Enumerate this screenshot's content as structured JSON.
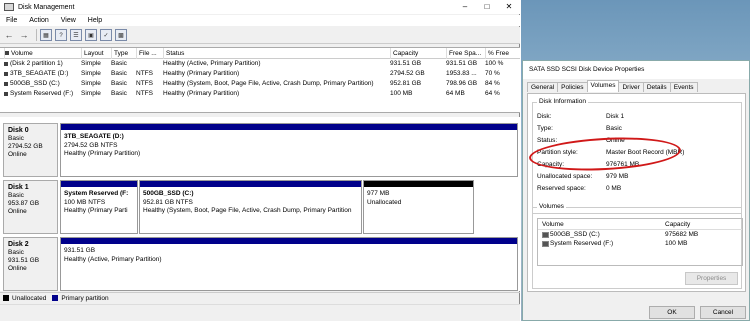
{
  "disk_management": {
    "title": "Disk Management",
    "menu": [
      "File",
      "Action",
      "View",
      "Help"
    ],
    "toolbar_icons": [
      "back-icon",
      "forward-icon",
      "console-tree-icon",
      "help-icon",
      "list-icon",
      "properties-icon",
      "refresh-icon",
      "export-icon"
    ],
    "volume_columns": [
      "Volume",
      "Layout",
      "Type",
      "File ...",
      "Status",
      "Capacity",
      "Free Spa...",
      "% Free"
    ],
    "volumes": [
      [
        "(Disk 2 partition 1)",
        "Simple",
        "Basic",
        "",
        "Healthy (Active, Primary Partition)",
        "931.51 GB",
        "931.51 GB",
        "100 %"
      ],
      [
        "3TB_SEAGATE (D:)",
        "Simple",
        "Basic",
        "NTFS",
        "Healthy (Primary Partition)",
        "2794.52 GB",
        "1953.83 ...",
        "70 %"
      ],
      [
        "500GB_SSD (C:)",
        "Simple",
        "Basic",
        "NTFS",
        "Healthy (System, Boot, Page File, Active, Crash Dump, Primary Partition)",
        "952.81 GB",
        "798.96 GB",
        "84 %"
      ],
      [
        "System Reserved (F:)",
        "Simple",
        "Basic",
        "NTFS",
        "Healthy (Primary Partition)",
        "100 MB",
        "64 MB",
        "64 %"
      ]
    ],
    "disks": [
      {
        "name": "Disk 0",
        "type": "Basic",
        "size": "2794.52 GB",
        "status": "Online",
        "partitions": [
          {
            "name": "3TB_SEAGATE  (D:)",
            "size": "2794.52 GB NTFS",
            "status": "Healthy (Primary Partition)"
          }
        ]
      },
      {
        "name": "Disk 1",
        "type": "Basic",
        "size": "953.87 GB",
        "status": "Online",
        "partitions": [
          {
            "name": "System Reserved  (F:",
            "size": "100 MB NTFS",
            "status": "Healthy (Primary Parti"
          },
          {
            "name": "500GB_SSD  (C:)",
            "size": "952.81 GB NTFS",
            "status": "Healthy (System, Boot, Page File, Active, Crash Dump, Primary Partition"
          },
          {
            "name": "",
            "size": "977 MB",
            "status": "Unallocated"
          }
        ]
      },
      {
        "name": "Disk 2",
        "type": "Basic",
        "size": "931.51 GB",
        "status": "Online",
        "partitions": [
          {
            "name": "",
            "size": "931.51 GB",
            "status": "Healthy (Active, Primary Partition)"
          }
        ]
      }
    ],
    "legend": {
      "unallocated": "Unallocated",
      "primary": "Primary partition"
    },
    "colors": {
      "primary": "#00008b",
      "unallocated": "#000000"
    }
  },
  "properties": {
    "title": "SATA SSD SCSI Disk Device Properties",
    "tabs": [
      "General",
      "Policies",
      "Volumes",
      "Driver",
      "Details",
      "Events"
    ],
    "disk_info_label": "Disk Information",
    "disk_info": [
      {
        "key": "Disk:",
        "value": "Disk 1"
      },
      {
        "key": "Type:",
        "value": "Basic"
      },
      {
        "key": "Status:",
        "value": "Online"
      },
      {
        "key": "Partition style:",
        "value": "Master Boot Record (MBR)"
      },
      {
        "key": "Capacity:",
        "value": "976761 MB"
      },
      {
        "key": "Unallocated space:",
        "value": "979 MB"
      },
      {
        "key": "Reserved space:",
        "value": "0 MB"
      }
    ],
    "volumes_label": "Volumes",
    "volume_columns": [
      "Volume",
      "Capacity"
    ],
    "volumes": [
      {
        "name": "500GB_SSD (C:)",
        "capacity": "975682 MB"
      },
      {
        "name": "System Reserved (F:)",
        "capacity": "100 MB"
      }
    ],
    "properties_button": "Properties",
    "ok_button": "OK",
    "cancel_button": "Cancel",
    "annotation_color": "#d01818"
  }
}
